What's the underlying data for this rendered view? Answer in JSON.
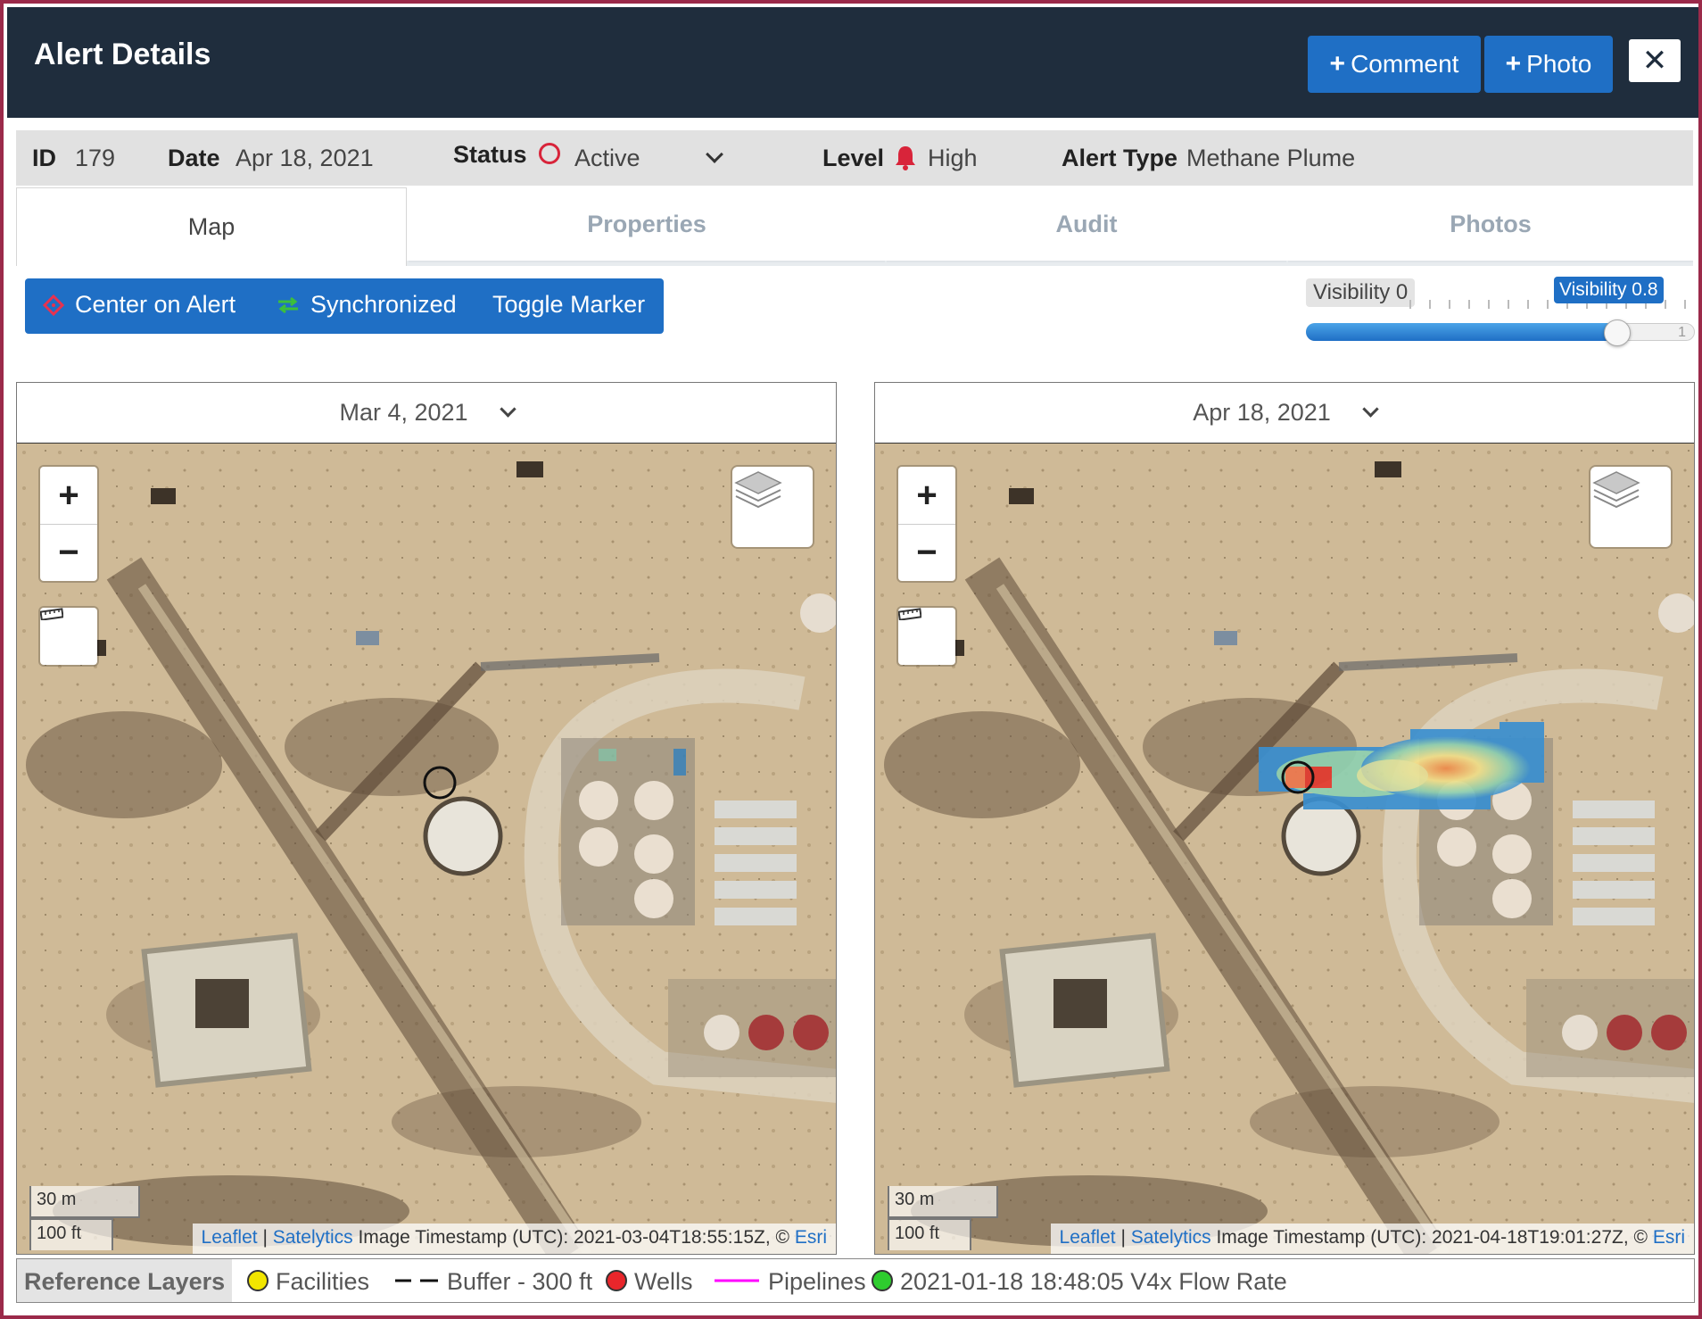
{
  "header": {
    "title": "Alert Details",
    "comment_label": "Comment",
    "photo_label": "Photo",
    "close_glyph": "✕"
  },
  "info": {
    "id_label": "ID",
    "id_value": "179",
    "date_label": "Date",
    "date_value": "Apr 18, 2021",
    "status_label": "Status",
    "status_value": "Active",
    "level_label": "Level",
    "level_value": "High",
    "type_label": "Alert Type",
    "type_value": "Methane Plume"
  },
  "tabs": [
    "Map",
    "Properties",
    "Audit",
    "Photos"
  ],
  "toolbar": {
    "center_label": "Center on Alert",
    "sync_label": "Synchronized",
    "toggle_label": "Toggle Marker"
  },
  "visibility": {
    "min_label": "Visibility 0",
    "max_label": "Visibility 0.8",
    "end_tick": "1",
    "value": 0.8
  },
  "maps": {
    "left": {
      "date": "Mar 4, 2021",
      "scale_metric": "30 m",
      "scale_imperial": "100 ft",
      "attr_leaflet": "Leaflet",
      "attr_sep": "|",
      "attr_satelytics": "Satelytics",
      "attr_text": "Image Timestamp (UTC): 2021-03-04T18:55:15Z, ©",
      "attr_esri": "Esri"
    },
    "right": {
      "date": "Apr 18, 2021",
      "scale_metric": "30 m",
      "scale_imperial": "100 ft",
      "attr_leaflet": "Leaflet",
      "attr_sep": "|",
      "attr_satelytics": "Satelytics",
      "attr_text": "Image Timestamp (UTC): 2021-04-18T19:01:27Z, ©",
      "attr_esri": "Esri"
    }
  },
  "legend": {
    "title": "Reference Layers",
    "facilities": "Facilities",
    "buffer": "Buffer - 300 ft",
    "wells": "Wells",
    "pipelines": "Pipelines",
    "flow": "2021-01-18 18:48:05 V4x Flow Rate"
  },
  "colors": {
    "header_bg": "#1f2d3d",
    "accent": "#1f6fc5",
    "status_red": "#d8243a",
    "facilities": "#f2e600",
    "wells": "#e8262b",
    "pipelines": "#ff00ff",
    "flow": "#2ecc2e"
  }
}
